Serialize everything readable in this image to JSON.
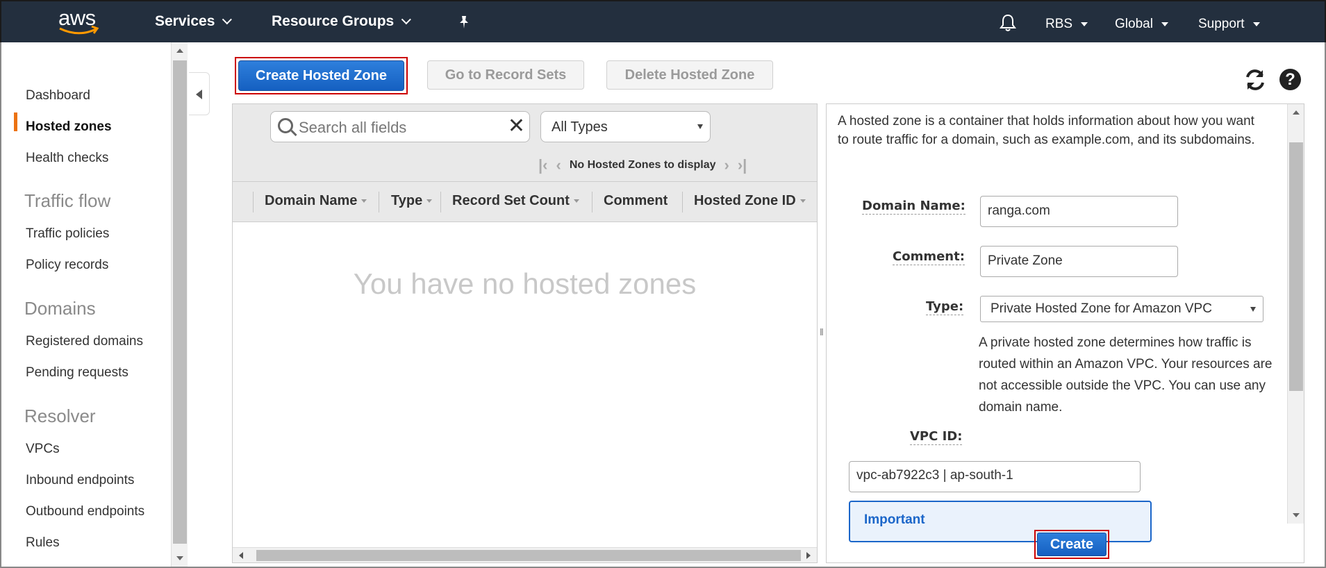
{
  "nav": {
    "logo_text": "aws",
    "services": "Services",
    "resource_groups": "Resource Groups",
    "pin_icon": "pin-icon",
    "bell_icon": "bell-icon",
    "account": "RBS",
    "region": "Global",
    "support": "Support"
  },
  "sidebar": {
    "items": [
      {
        "label": "Dashboard"
      },
      {
        "label": "Hosted zones",
        "active": true
      },
      {
        "label": "Health checks"
      },
      {
        "label": "Traffic policies"
      },
      {
        "label": "Policy records"
      },
      {
        "label": "Registered domains"
      },
      {
        "label": "Pending requests"
      },
      {
        "label": "VPCs"
      },
      {
        "label": "Inbound endpoints"
      },
      {
        "label": "Outbound endpoints"
      },
      {
        "label": "Rules"
      }
    ],
    "sections": [
      "Traffic flow",
      "Domains",
      "Resolver"
    ],
    "accent_color": "#ec7211"
  },
  "toolbar": {
    "create_hosted_zone": "Create Hosted Zone",
    "go_to_record_sets": "Go to Record Sets",
    "delete_hosted_zone": "Delete Hosted Zone",
    "help_glyph": "?"
  },
  "table": {
    "search_placeholder": "Search all fields",
    "type_filter": "All Types",
    "pager_text": "No Hosted Zones to display",
    "columns": [
      "Domain Name",
      "Type",
      "Record Set Count",
      "Comment",
      "Hosted Zone ID"
    ],
    "empty_message": "You have no hosted zones"
  },
  "form": {
    "description": "A hosted zone is a container that holds information about how you want to route traffic for a domain, such as example.com, and its subdomains.",
    "domain_name_label": "Domain Name:",
    "domain_name_value": "ranga.com",
    "comment_label": "Comment:",
    "comment_value": "Private Zone",
    "type_label": "Type:",
    "type_value": "Private Hosted Zone for Amazon VPC",
    "type_help": "A private hosted zone determines how traffic is routed within an Amazon VPC. Your resources are not accessible outside the VPC. You can use any domain name.",
    "vpc_id_label": "VPC ID:",
    "vpc_id_value": "vpc-ab7922c3 | ap-south-1",
    "important_title": "Important",
    "create_button": "Create"
  },
  "colors": {
    "topnav_bg": "#232f3e",
    "primary_button": "#1560c1",
    "highlight_outline": "#cc0000"
  }
}
